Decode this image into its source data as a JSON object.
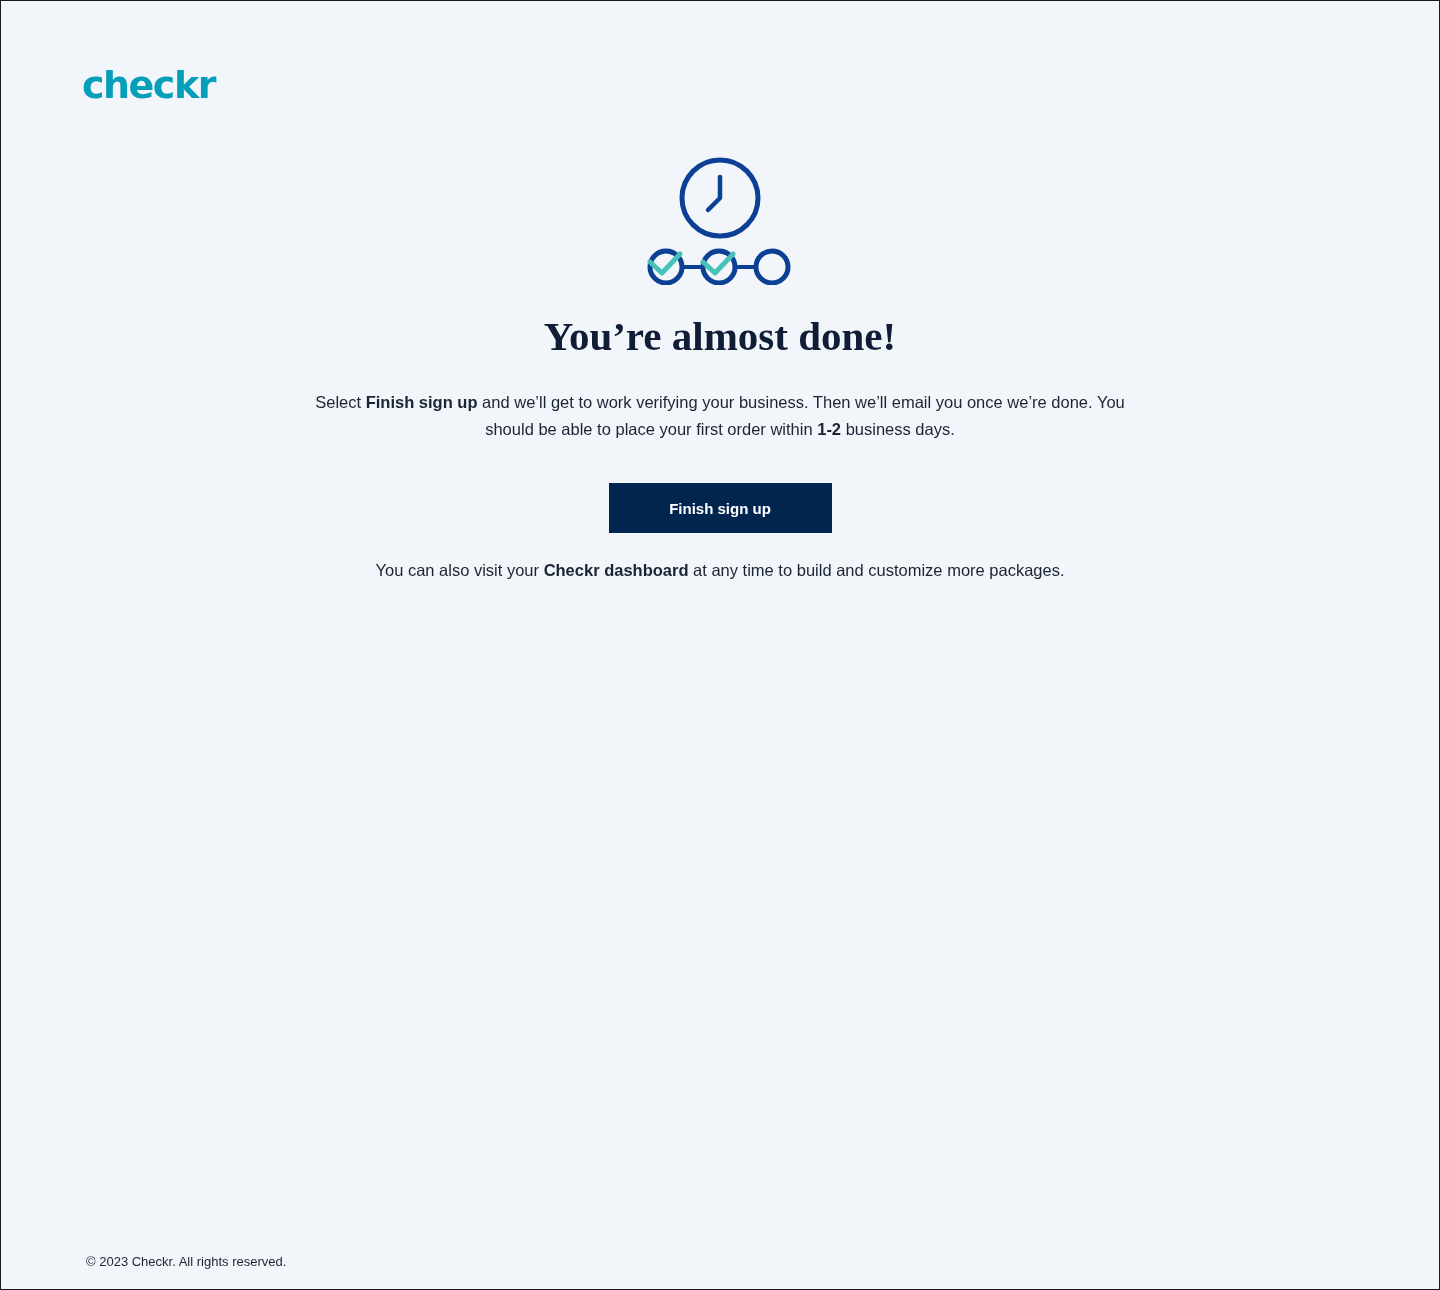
{
  "logo": {
    "text": "checkr"
  },
  "steps": [
    {
      "checked": true
    },
    {
      "checked": true
    },
    {
      "checked": false
    }
  ],
  "heading": "You’re almost done!",
  "message": "Select **Finish sign up** and we’ll get to work verifying your business. Then we’ll email you once we’re done. You should be able to place your first order within **1-2** business days.",
  "button": {
    "label": "Finish sign up"
  },
  "note": "You can also visit your **Checkr dashboard** at any time to build and customize more packages.",
  "footer": "© 2023 Checkr. All rights reserved."
}
